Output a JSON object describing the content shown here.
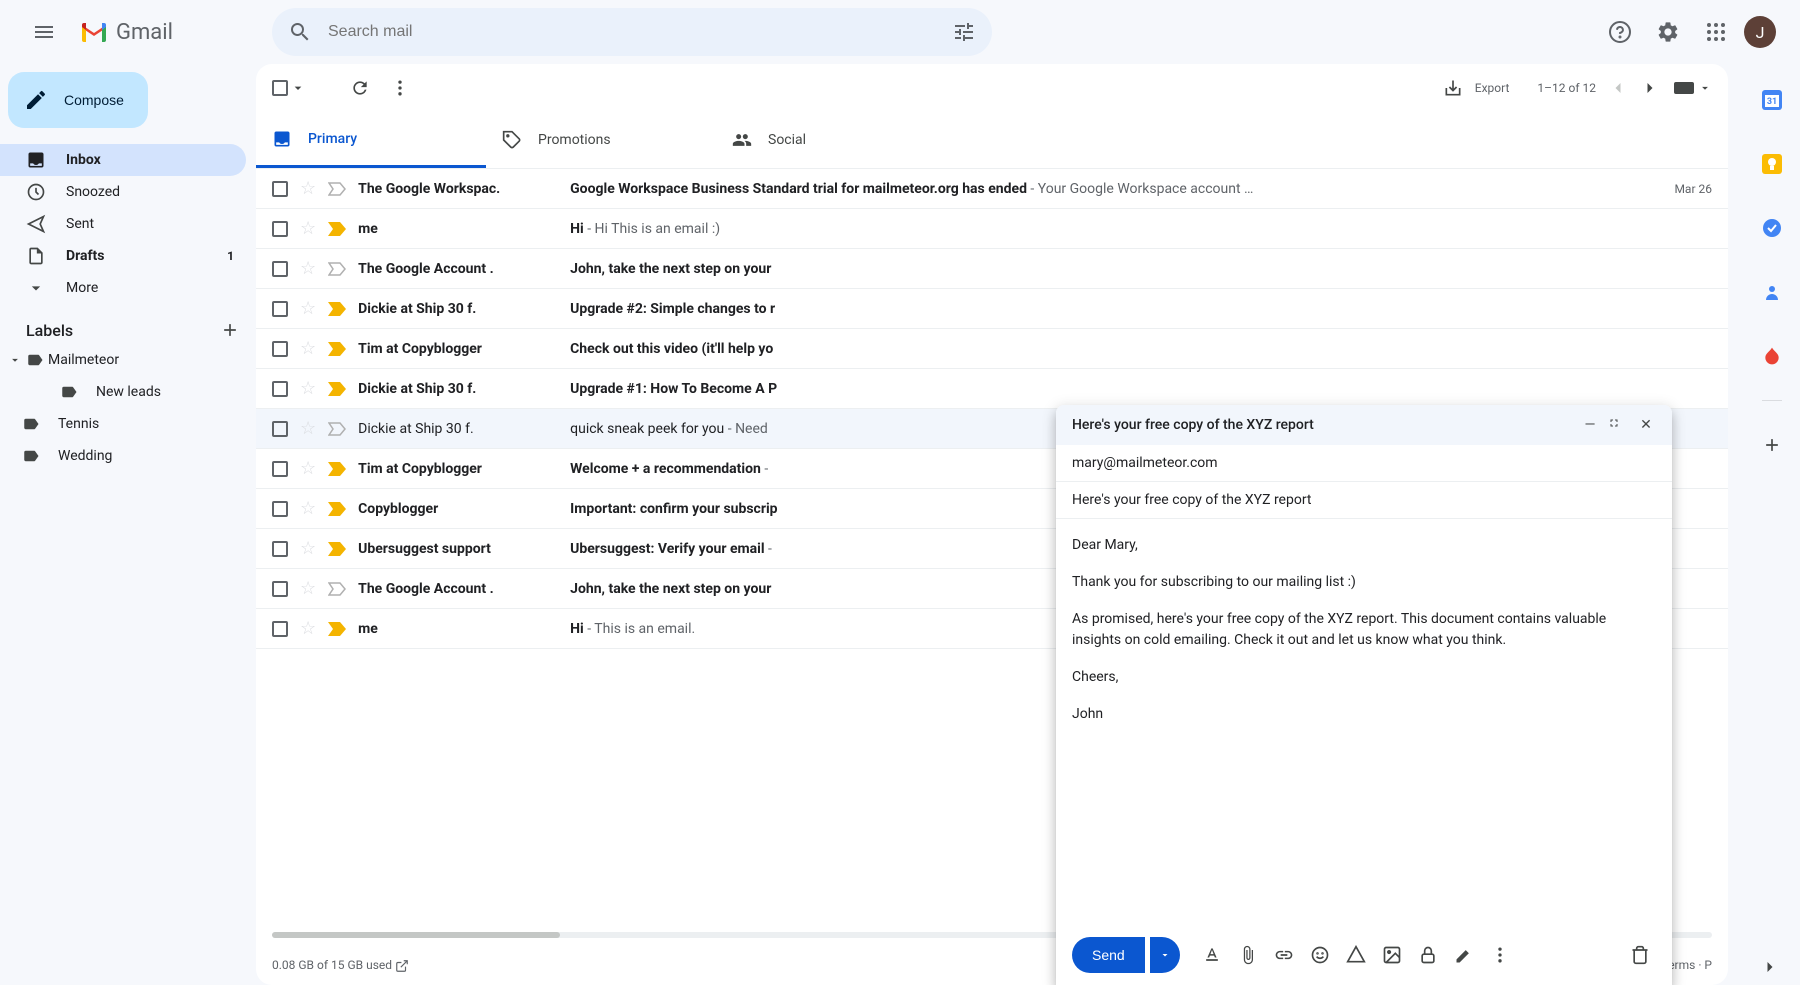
{
  "header": {
    "logo_text": "Gmail",
    "search_placeholder": "Search mail",
    "avatar_initial": "J"
  },
  "compose_button": "Compose",
  "nav": {
    "inbox": "Inbox",
    "snoozed": "Snoozed",
    "sent": "Sent",
    "drafts": "Drafts",
    "drafts_count": "1",
    "more": "More"
  },
  "labels": {
    "header": "Labels",
    "items": [
      "Mailmeteor",
      "New leads",
      "Tennis",
      "Wedding"
    ]
  },
  "toolbar": {
    "export": "Export",
    "range": "1–12 of 12"
  },
  "tabs": {
    "primary": "Primary",
    "promotions": "Promotions",
    "social": "Social"
  },
  "emails": [
    {
      "sender": "The Google Workspac.",
      "subject": "Google Workspace Business Standard trial for mailmeteor.org has ended",
      "snippet": " - Your Google Workspace account …",
      "date": "Mar 26",
      "unread": true,
      "marker": "gray"
    },
    {
      "sender": "me",
      "subject": "Hi",
      "snippet": " - Hi This is an email :)",
      "date": "",
      "unread": true,
      "marker": "yellow"
    },
    {
      "sender": "The Google Account .",
      "subject": "John, take the next step on your",
      "snippet": "",
      "date": "",
      "unread": true,
      "marker": "gray"
    },
    {
      "sender": "Dickie at Ship 30 f.",
      "subject": "Upgrade #2: Simple changes to r",
      "snippet": "",
      "date": "",
      "unread": true,
      "marker": "yellow"
    },
    {
      "sender": "Tim at Copyblogger",
      "subject": "Check out this video (it'll help yo",
      "snippet": "",
      "date": "",
      "unread": true,
      "marker": "yellow"
    },
    {
      "sender": "Dickie at Ship 30 f.",
      "subject": "Upgrade #1: How To Become A P",
      "snippet": "",
      "date": "",
      "unread": true,
      "marker": "yellow"
    },
    {
      "sender": "Dickie at Ship 30 f.",
      "subject": "quick sneak peek for you",
      "snippet": " - Need",
      "date": "",
      "unread": false,
      "marker": "gray"
    },
    {
      "sender": "Tim at Copyblogger",
      "subject": "Welcome + a recommendation",
      "snippet": " -",
      "date": "",
      "unread": true,
      "marker": "yellow"
    },
    {
      "sender": "Copyblogger",
      "subject": "Important: confirm your subscrip",
      "snippet": "",
      "date": "",
      "unread": true,
      "marker": "yellow"
    },
    {
      "sender": "Ubersuggest support",
      "subject": "Ubersuggest: Verify your email",
      "snippet": " -",
      "date": "",
      "unread": true,
      "marker": "yellow"
    },
    {
      "sender": "The Google Account .",
      "subject": "John, take the next step on your",
      "snippet": "",
      "date": "",
      "unread": true,
      "marker": "gray"
    },
    {
      "sender": "me",
      "subject": "Hi",
      "snippet": " - This is an email.",
      "date": "",
      "unread": true,
      "marker": "yellow"
    }
  ],
  "footer": {
    "storage": "0.08 GB of 15 GB used",
    "terms": "Terms · P"
  },
  "compose": {
    "title": "Here's your free copy of the XYZ report",
    "to": "mary@mailmeteor.com",
    "subject": "Here's your free copy of the XYZ report",
    "body_p1": "Dear Mary,",
    "body_p2": "Thank you for subscribing to our mailing list :)",
    "body_p3": "As promised, here's your free copy of the XYZ report. This document contains valuable insights on cold emailing. Check it out and let us know what you think.",
    "body_p4": "Cheers,",
    "body_p5": "John",
    "send": "Send"
  }
}
